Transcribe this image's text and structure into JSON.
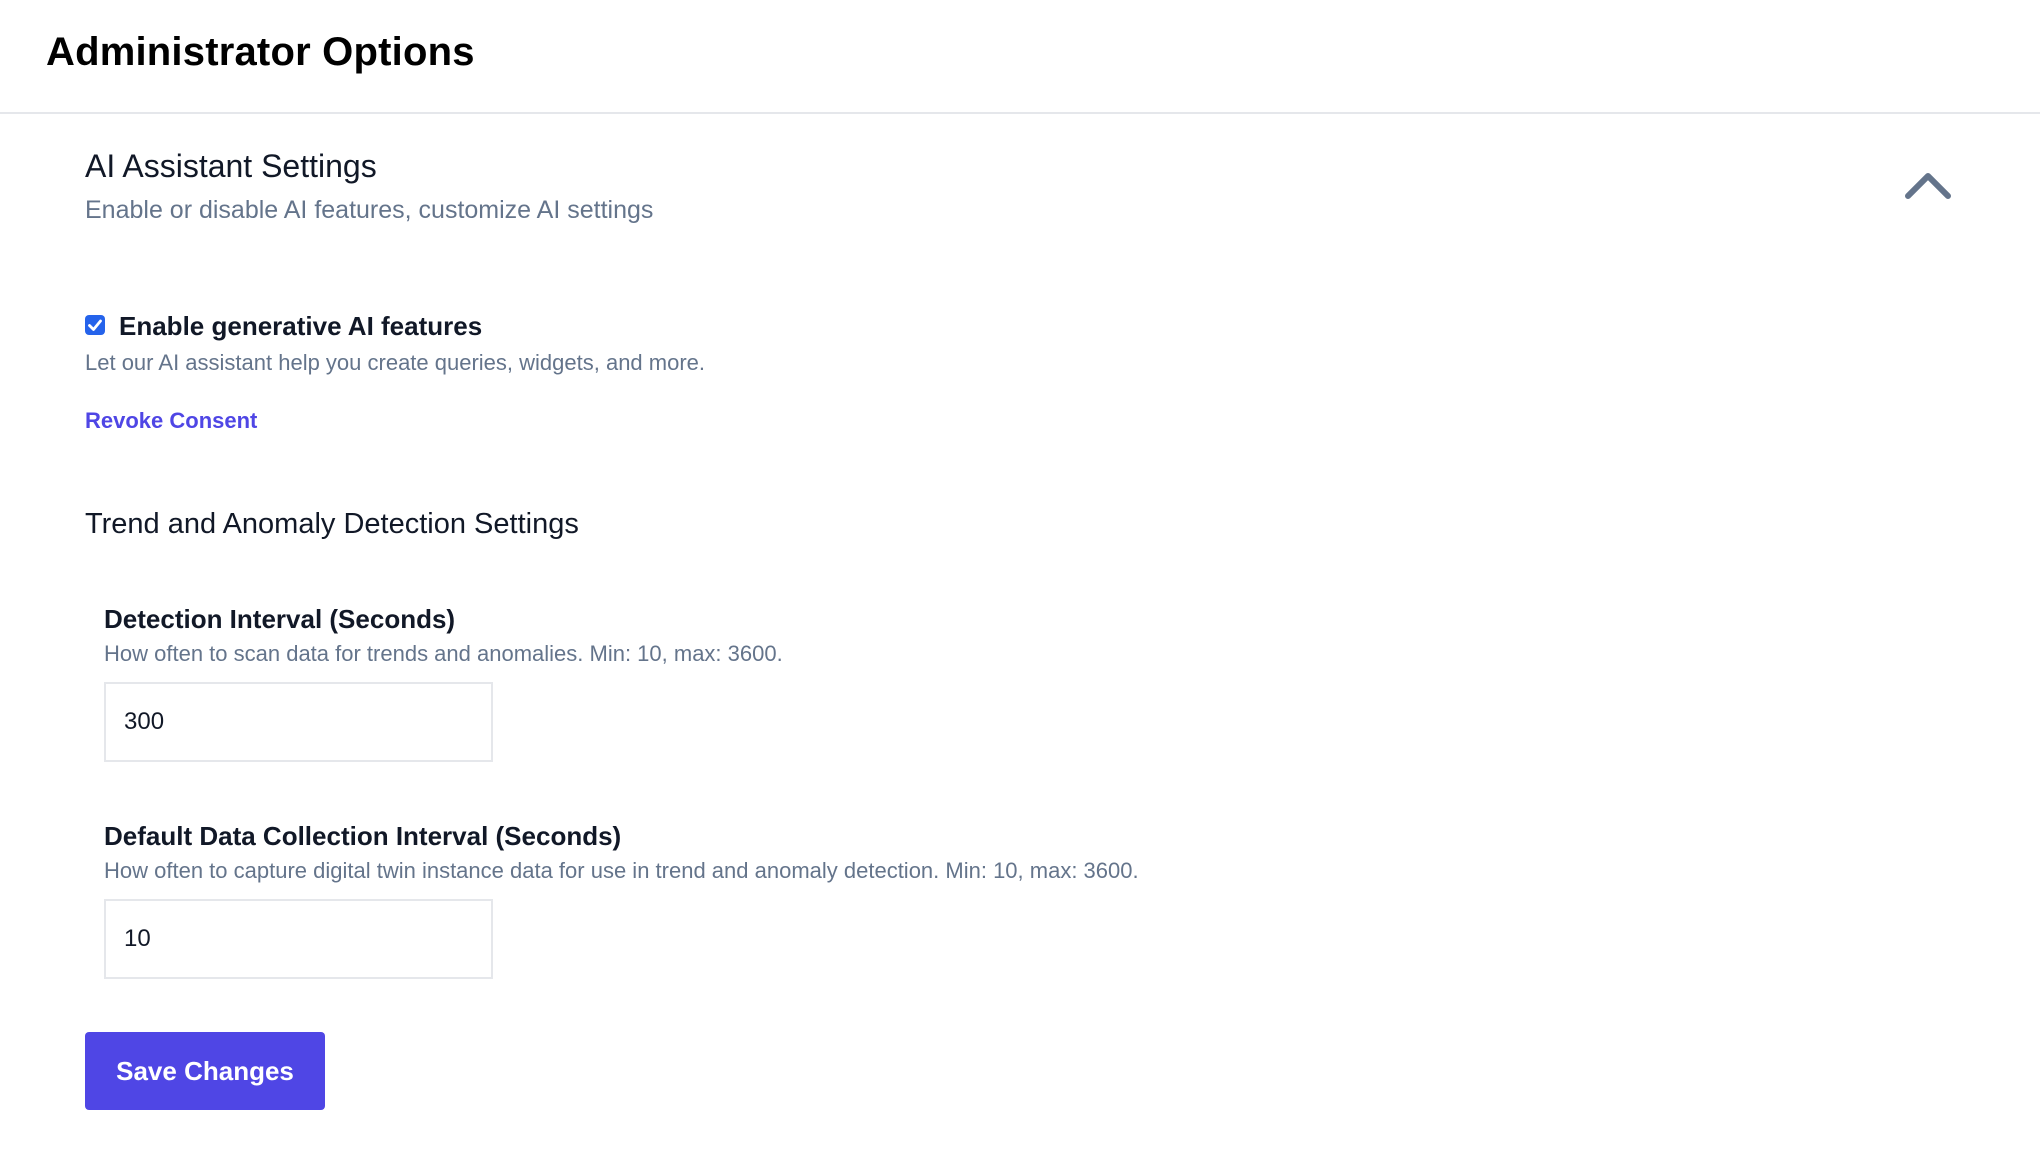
{
  "header": {
    "title": "Administrator Options"
  },
  "ai_section": {
    "title": "AI Assistant Settings",
    "subtitle": "Enable or disable AI features, customize AI settings",
    "collapse_icon": "chevron-up-icon",
    "generative_ai": {
      "label": "Enable generative AI features",
      "checked": true,
      "description": "Let our AI assistant help you create queries, widgets, and more."
    },
    "revoke_link": "Revoke Consent"
  },
  "trend_section": {
    "title": "Trend and Anomaly Detection Settings",
    "detection_interval": {
      "label": "Detection Interval (Seconds)",
      "help": "How often to scan data for trends and anomalies. Min: 10, max: 3600.",
      "value": "300"
    },
    "collection_interval": {
      "label": "Default Data Collection Interval (Seconds)",
      "help": "How often to capture digital twin instance data for use in trend and anomaly detection. Min: 10, max: 3600.",
      "value": "10"
    }
  },
  "actions": {
    "save_label": "Save Changes"
  },
  "colors": {
    "accent": "#4f46e5",
    "checkbox": "#2563eb",
    "muted_text": "#64748b",
    "border": "#e5e7eb"
  }
}
